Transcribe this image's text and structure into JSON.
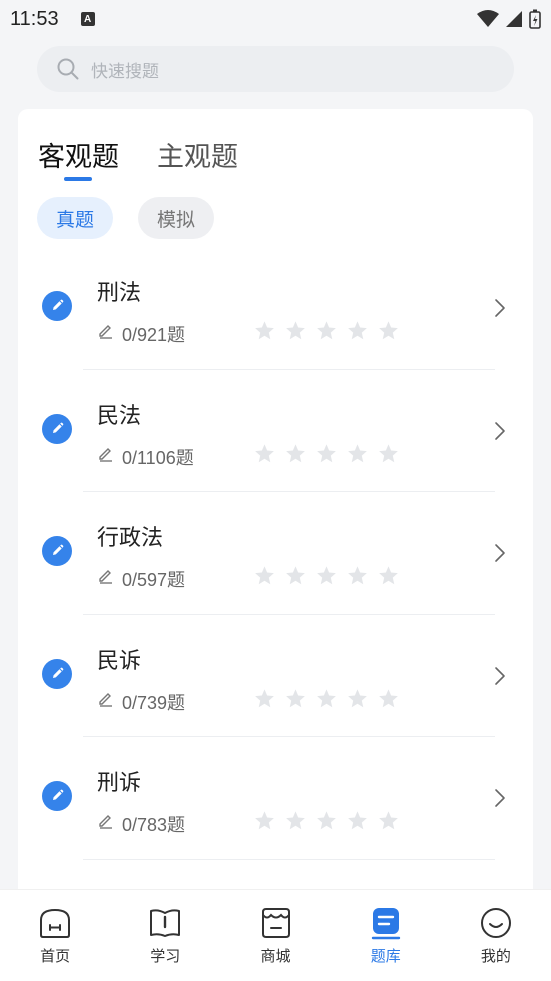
{
  "status_bar": {
    "time": "11:53",
    "notification_icon": "A"
  },
  "search": {
    "placeholder": "快速搜题"
  },
  "tabs": [
    {
      "label": "客观题",
      "active": true
    },
    {
      "label": "主观题",
      "active": false
    }
  ],
  "filters": [
    {
      "label": "真题",
      "active": true
    },
    {
      "label": "模拟",
      "active": false
    }
  ],
  "subjects": [
    {
      "title": "刑法",
      "done": "0/921",
      "unit": "题",
      "stars": 0
    },
    {
      "title": "民法",
      "done": "0/1106",
      "unit": "题",
      "stars": 0
    },
    {
      "title": "行政法",
      "done": "0/597",
      "unit": "题",
      "stars": 0
    },
    {
      "title": "民诉",
      "done": "0/739",
      "unit": "题",
      "stars": 0
    },
    {
      "title": "刑诉",
      "done": "0/783",
      "unit": "题",
      "stars": 0
    }
  ],
  "bottom_nav": [
    {
      "label": "首页",
      "icon": "home-icon",
      "active": false
    },
    {
      "label": "学习",
      "icon": "book-icon",
      "active": false
    },
    {
      "label": "商城",
      "icon": "store-icon",
      "active": false
    },
    {
      "label": "题库",
      "icon": "question-bank-icon",
      "active": true
    },
    {
      "label": "我的",
      "icon": "smile-icon",
      "active": false
    }
  ],
  "colors": {
    "accent": "#2b79e6",
    "star_empty": "#e3e5e8"
  }
}
